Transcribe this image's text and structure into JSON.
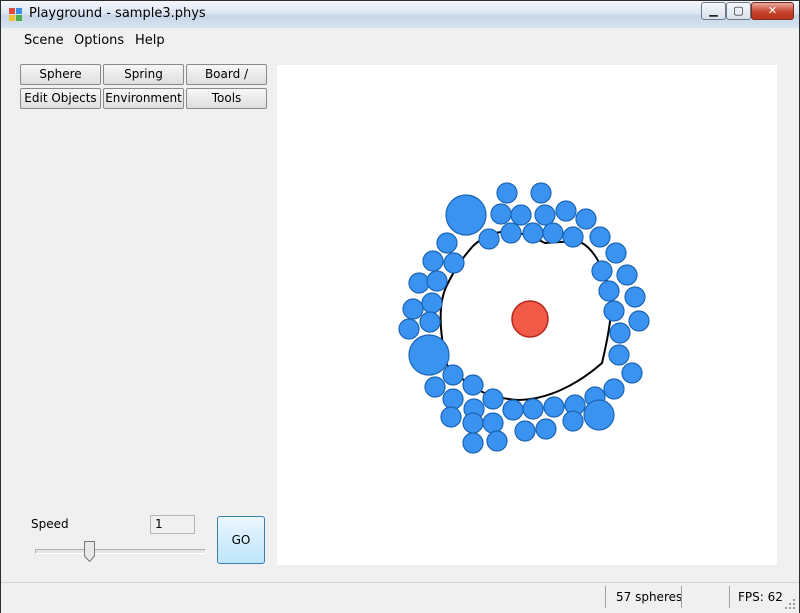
{
  "window": {
    "title": "Playground - sample3.phys"
  },
  "title_controls": {
    "minimize": "▁",
    "maximize": "▢",
    "close": "✕"
  },
  "menu": [
    "Scene",
    "Options",
    "Help"
  ],
  "tool_buttons": [
    "Sphere",
    "Spring",
    "Board / Curve",
    "Edit Objects",
    "Environment",
    "Tools"
  ],
  "speed": {
    "label": "Speed",
    "value": "1",
    "slider_level": 0.3
  },
  "go_label": "GO",
  "status": {
    "spheres": "57 spheres",
    "fps": "FPS: 62"
  },
  "colors": {
    "sphere_fill": "#3a93f0",
    "sphere_stroke": "#1c64b4",
    "center_fill": "#f05a47",
    "center_stroke": "#b7261a",
    "board": "#000000"
  }
}
